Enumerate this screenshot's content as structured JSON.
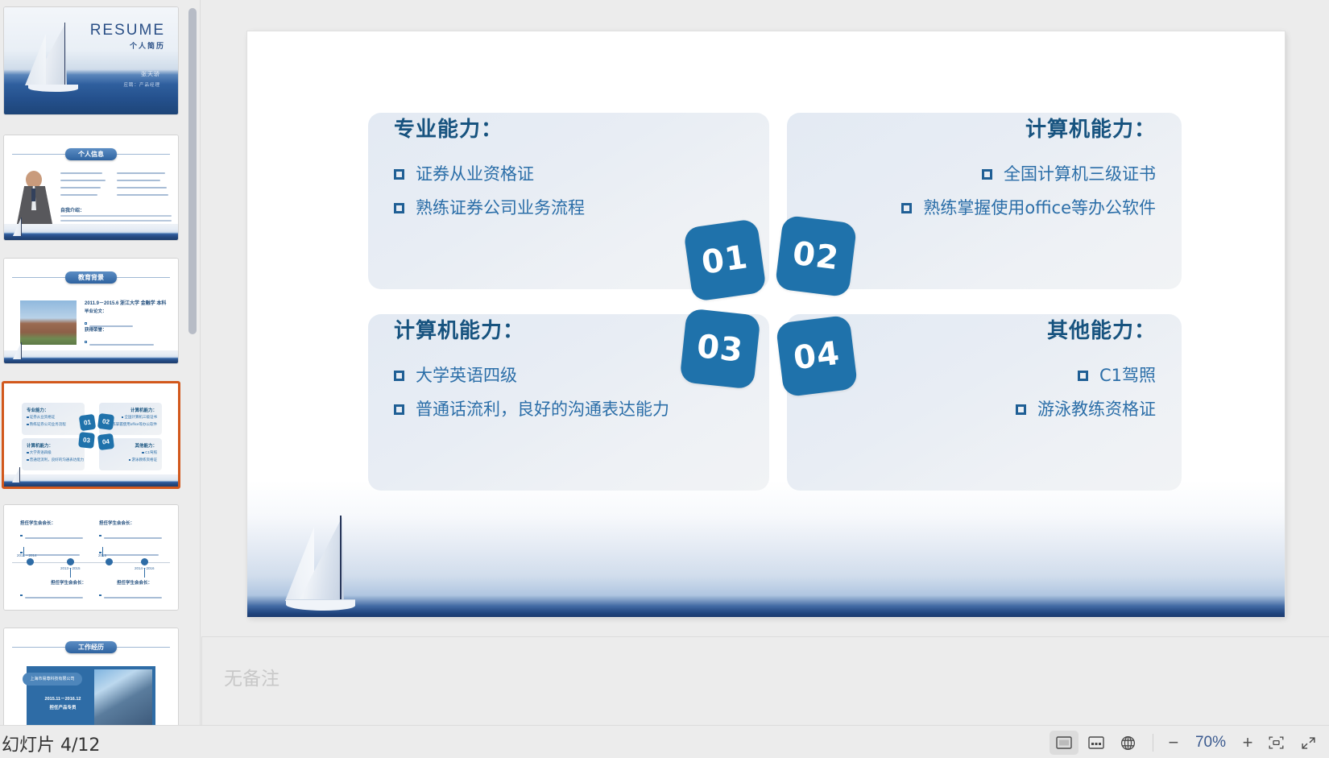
{
  "window": {
    "app": "presentation-editor"
  },
  "thumbnails": {
    "scrollbar": "vertical-scrollbar",
    "items": [
      {
        "index": "1",
        "kind": "cover",
        "title": "RESUME",
        "subtitle": "个人简历",
        "name": "张天骄",
        "role": "应聘：产品经理",
        "selected": "false"
      },
      {
        "index": "2",
        "kind": "info",
        "header": "个人信息",
        "section_label": "自我介绍：",
        "selected": "false"
      },
      {
        "index": "3",
        "kind": "education",
        "header": "教育背景",
        "line1": "2011.9－2015.6   浙江大学   金融学   本科",
        "line2": "毕业论文：",
        "line3": "获得荣誉：",
        "selected": "false"
      },
      {
        "index": "4",
        "kind": "skills",
        "selected": "true",
        "cards": [
          {
            "badge": "01",
            "title": "专业能力：",
            "bullets": [
              "证券从业资格证",
              "熟练证券公司业务流程"
            ]
          },
          {
            "badge": "02",
            "title": "计算机能力：",
            "bullets": [
              "全国计算机三级证书",
              "熟练掌握使用office等办公软件"
            ]
          },
          {
            "badge": "03",
            "title": "计算机能力：",
            "bullets": [
              "大学英语四级",
              "普通话流利，良好的沟通表达能力"
            ]
          },
          {
            "badge": "04",
            "title": "其他能力：",
            "bullets": [
              "C1驾照",
              "游泳教练资格证"
            ]
          }
        ]
      },
      {
        "index": "5",
        "kind": "timeline",
        "entries": [
          "2012－2014",
          "2013－2015",
          "2015",
          "2014－2016"
        ],
        "block_title": "担任学生会会长：",
        "selected": "false"
      },
      {
        "index": "6",
        "kind": "work",
        "header": "工作经历",
        "company": "上海市易尊科技有限公司",
        "period": "2015.11－2016.12",
        "position": "担任产品专员",
        "selected": "false"
      }
    ]
  },
  "slide": {
    "cards": [
      {
        "badge": "01",
        "title": "专业能力：",
        "align": "left",
        "bullets": [
          "证券从业资格证",
          "熟练证券公司业务流程"
        ]
      },
      {
        "badge": "02",
        "title": "计算机能力：",
        "align": "right",
        "bullets": [
          "全国计算机三级证书",
          "熟练掌握使用office等办公软件"
        ]
      },
      {
        "badge": "03",
        "title": "计算机能力：",
        "align": "left",
        "bullets": [
          "大学英语四级",
          "普通话流利，良好的沟通表达能力"
        ]
      },
      {
        "badge": "04",
        "title": "其他能力：",
        "align": "right",
        "bullets": [
          "C1驾照",
          "游泳教练资格证"
        ]
      }
    ],
    "colors": {
      "badge_blue": "#1f72ab",
      "title_blue": "#17537f",
      "bullet_blue": "#2b6ea8",
      "card_bg": "#e6ecf4"
    }
  },
  "notes": {
    "placeholder": "无备注"
  },
  "statusbar": {
    "slide_counter": "幻灯片 4/12",
    "view_normal": "normal-view",
    "view_sorter": "slide-sorter-view",
    "view_reading": "reading-view",
    "zoom_out": "−",
    "zoom_level": "70%",
    "zoom_in": "+",
    "fit_label": "fit-to-window",
    "fullscreen_label": "fullscreen"
  }
}
